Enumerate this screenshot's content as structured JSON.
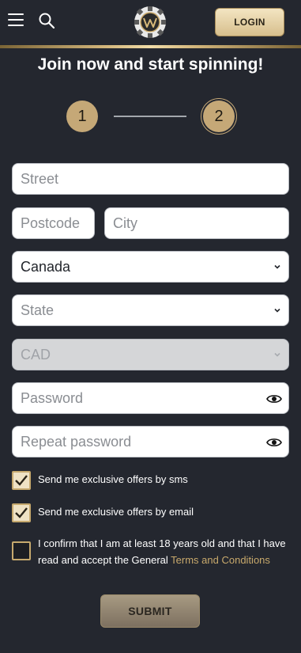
{
  "header": {
    "login_label": "LOGIN"
  },
  "title": "Join now and start spinning!",
  "steps": [
    "1",
    "2"
  ],
  "form": {
    "street_placeholder": "Street",
    "postcode_placeholder": "Postcode",
    "city_placeholder": "City",
    "country_value": "Canada",
    "state_placeholder": "State",
    "currency_value": "CAD",
    "password_placeholder": "Password",
    "repeat_password_placeholder": "Repeat password"
  },
  "consents": {
    "sms_label": "Send me exclusive offers by sms",
    "sms_checked": true,
    "email_label": "Send me exclusive offers by email",
    "email_checked": true,
    "age_label": "I confirm that I am at least 18 years old and that I have read and accept the General",
    "terms_link": "Terms and Conditions",
    "age_checked": false
  },
  "submit_label": "SUBMIT",
  "colors": {
    "background": "#24272f",
    "gold": "#c5a877",
    "link": "#c8a96c"
  },
  "icons": [
    "hamburger-menu-icon",
    "search-icon",
    "casino-chip-logo",
    "chevron-down-icon",
    "eye-icon",
    "checkmark-icon"
  ]
}
